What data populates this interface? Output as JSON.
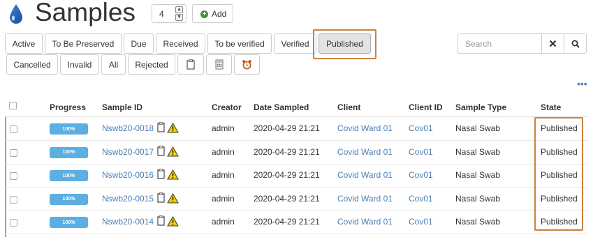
{
  "header": {
    "title": "Samples",
    "count_value": "4",
    "add_label": "Add"
  },
  "filters": {
    "row1": [
      "Active",
      "To Be Preserved",
      "Due",
      "Received",
      "To be verified",
      "Verified",
      "Published"
    ],
    "row2": [
      "Cancelled",
      "Invalid",
      "All",
      "Rejected"
    ],
    "row2_icons": [
      "clipboard-icon",
      "calculator-icon",
      "alarm-clock-icon"
    ],
    "active": "Published"
  },
  "search": {
    "placeholder": "Search",
    "clear_icon": "close-icon",
    "go_icon": "search-icon"
  },
  "table": {
    "columns": [
      "Progress",
      "Sample ID",
      "Creator",
      "Date Sampled",
      "Client",
      "Client ID",
      "Sample Type",
      "State"
    ],
    "rows": [
      {
        "progress": "100%",
        "sample_id": "Nswb20-0018",
        "creator": "admin",
        "date": "2020-04-29 21:21",
        "client": "Covid Ward 01",
        "client_id": "Cov01",
        "type": "Nasal Swab",
        "state": "Published"
      },
      {
        "progress": "100%",
        "sample_id": "Nswb20-0017",
        "creator": "admin",
        "date": "2020-04-29 21:21",
        "client": "Covid Ward 01",
        "client_id": "Cov01",
        "type": "Nasal Swab",
        "state": "Published"
      },
      {
        "progress": "100%",
        "sample_id": "Nswb20-0016",
        "creator": "admin",
        "date": "2020-04-29 21:21",
        "client": "Covid Ward 01",
        "client_id": "Cov01",
        "type": "Nasal Swab",
        "state": "Published"
      },
      {
        "progress": "100%",
        "sample_id": "Nswb20-0015",
        "creator": "admin",
        "date": "2020-04-29 21:21",
        "client": "Covid Ward 01",
        "client_id": "Cov01",
        "type": "Nasal Swab",
        "state": "Published"
      },
      {
        "progress": "100%",
        "sample_id": "Nswb20-0014",
        "creator": "admin",
        "date": "2020-04-29 21:21",
        "client": "Covid Ward 01",
        "client_id": "Cov01",
        "type": "Nasal Swab",
        "state": "Published"
      }
    ]
  },
  "colors": {
    "link": "#4a7fb5",
    "progress": "#5bafe3",
    "highlight": "#c8823f",
    "left_bar": "#6ec06e"
  }
}
